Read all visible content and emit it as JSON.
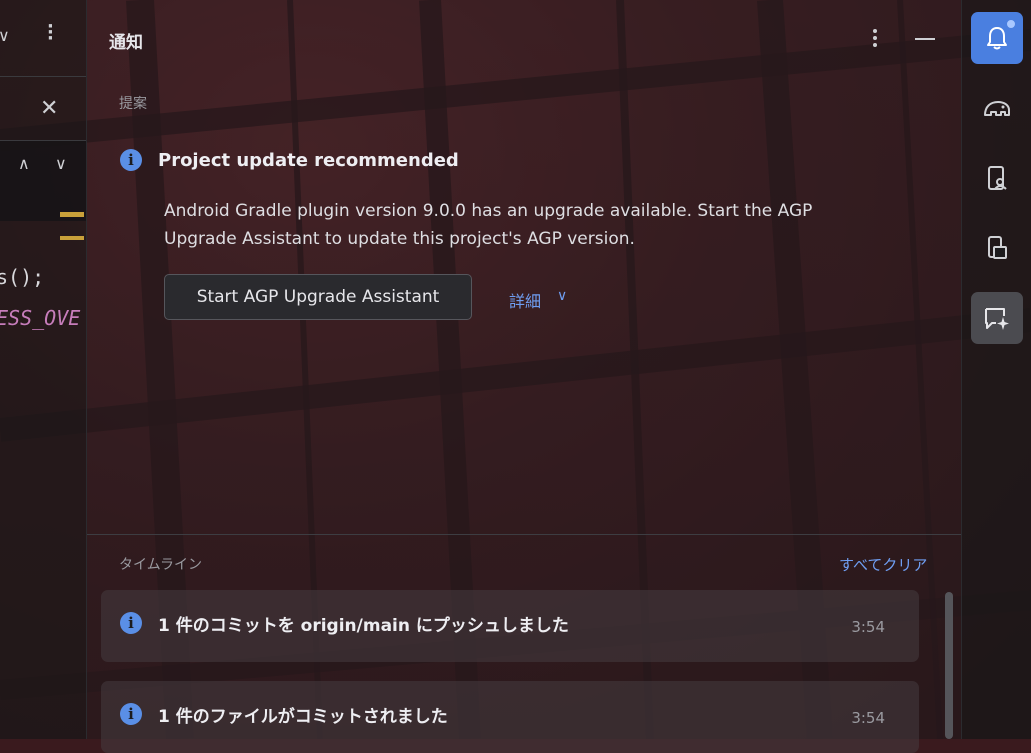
{
  "editor": {
    "code_line1": "s();",
    "code_line2": "ESS_OVE"
  },
  "panel": {
    "title": "通知",
    "suggestions_header": "提案",
    "timeline_header": "タイムライン",
    "clear_all_label": "すべてクリア"
  },
  "suggestion": {
    "title": "Project update recommended",
    "body": "Android Gradle plugin version 9.0.0 has an upgrade available. Start the AGP Upgrade Assistant to update this project's AGP version.",
    "button_label": "Start AGP Upgrade Assistant",
    "more_label": "詳細"
  },
  "timeline": [
    {
      "text": "1 件のコミットを origin/main にプッシュしました",
      "time": "3:54"
    },
    {
      "text": "1 件のファイルがコミットされました",
      "time": "3:54"
    }
  ],
  "toolstrip": {
    "items": [
      "bell-icon",
      "gradle-elephant-icon",
      "device-manager-icon",
      "running-devices-icon",
      "ai-chat-icon"
    ]
  },
  "colors": {
    "accent": "#4a7fe0",
    "link": "#6f9ef2",
    "info": "#5a8fe6"
  }
}
